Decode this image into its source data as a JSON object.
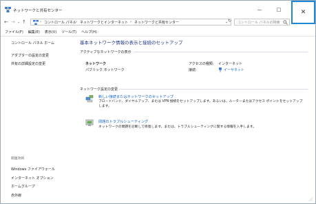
{
  "window": {
    "title": "ネットワークと共有センター",
    "minimize_glyph": "—",
    "maximize_glyph": "□",
    "close_glyph": "✕"
  },
  "nav": {
    "back_glyph": "←",
    "forward_glyph": "→",
    "dropdown_glyph": "⌄",
    "up_glyph": "↑",
    "refresh_glyph": "↻"
  },
  "address": {
    "breadcrumbs": [
      "コントロール パネル",
      "ネットワークとインターネット",
      "ネットワークと共有センター"
    ],
    "separator": "›"
  },
  "search": {
    "placeholder": "コントロール パネルの検索"
  },
  "menu": {
    "items": [
      "ファイル(F)",
      "編集(E)",
      "表示(V)",
      "ツール(T)",
      "ヘルプ(H)"
    ]
  },
  "sidebar": {
    "home": "コントロール パネル ホーム",
    "links": [
      "アダプターの設定の変更",
      "共有の詳細設定の変更"
    ],
    "see_also_header": "関連項目",
    "see_also": [
      "Windows ファイアウォール",
      "インターネット オプション",
      "ホームグループ",
      "赤外線"
    ]
  },
  "main": {
    "title": "基本ネットワーク情報の表示と接続のセットアップ",
    "active_header": "アクティブなネットワークの表示",
    "network_name": "ネットワーク",
    "network_type": "パブリック ネットワーク",
    "access_type_label": "アクセスの種類:",
    "access_type_value": "インターネット",
    "connections_label": "接続:",
    "connections_value": "イーサネット",
    "change_header": "ネットワーク設定の変更",
    "tasks": [
      {
        "title": "新しい接続またはネットワークのセットアップ",
        "desc": "ブロードバンド、ダイヤルアップ、または VPN 接続をセットアップします。あるいは、ルーターまたはアクセス ポイントをセットアップします。"
      },
      {
        "title": "問題のトラブルシューティング",
        "desc": "ネットワークの問題を診断して修復します。または、トラブルシューティングに関する情報を入手します。"
      }
    ]
  },
  "colors": {
    "accent": "#1e88d6",
    "title_blue": "#1e3287",
    "link_blue": "#1060c8"
  }
}
